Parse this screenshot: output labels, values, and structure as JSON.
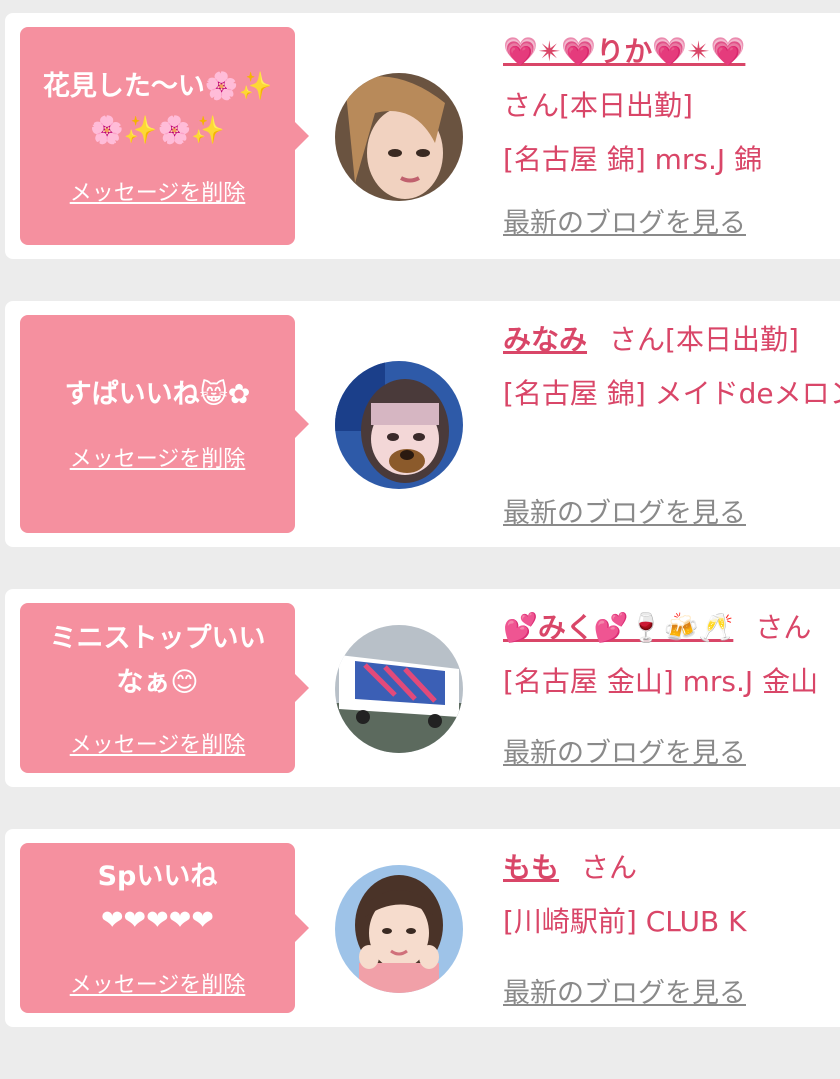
{
  "colors": {
    "bubble": "#f5909f",
    "accent": "#d94668",
    "link": "#8a8a8a",
    "background": "#ececec"
  },
  "delete_label": "メッセージを削除",
  "blog_label": "最新のブログを見る",
  "cards": [
    {
      "message": "花見した〜い🌸✨\n🌸✨🌸✨",
      "name": "💗✴💗りか💗✴💗",
      "honorific": "さん",
      "status": "[本日出勤]",
      "shop": "[名古屋 錦] mrs.J 錦",
      "avatar_icon": "profile-photo-icon"
    },
    {
      "message": "すぱいいね😸✿",
      "name": "みなみ",
      "honorific": "さん",
      "status": "[本日出勤]",
      "shop": "[名古屋 錦] メイドdeメロン",
      "avatar_icon": "profile-photo-icon"
    },
    {
      "message": "ミニストップいい\nなぁ😊",
      "name": "💕みく💕🍷🍻🥂",
      "honorific": "さん",
      "status": "",
      "shop": "[名古屋 金山] mrs.J 金山",
      "avatar_icon": "profile-photo-icon"
    },
    {
      "message": "Spいいね\n❤❤❤❤❤",
      "name": "もも",
      "honorific": "さん",
      "status": "",
      "shop": "[川崎駅前] CLUB K",
      "avatar_icon": "profile-photo-icon"
    }
  ]
}
